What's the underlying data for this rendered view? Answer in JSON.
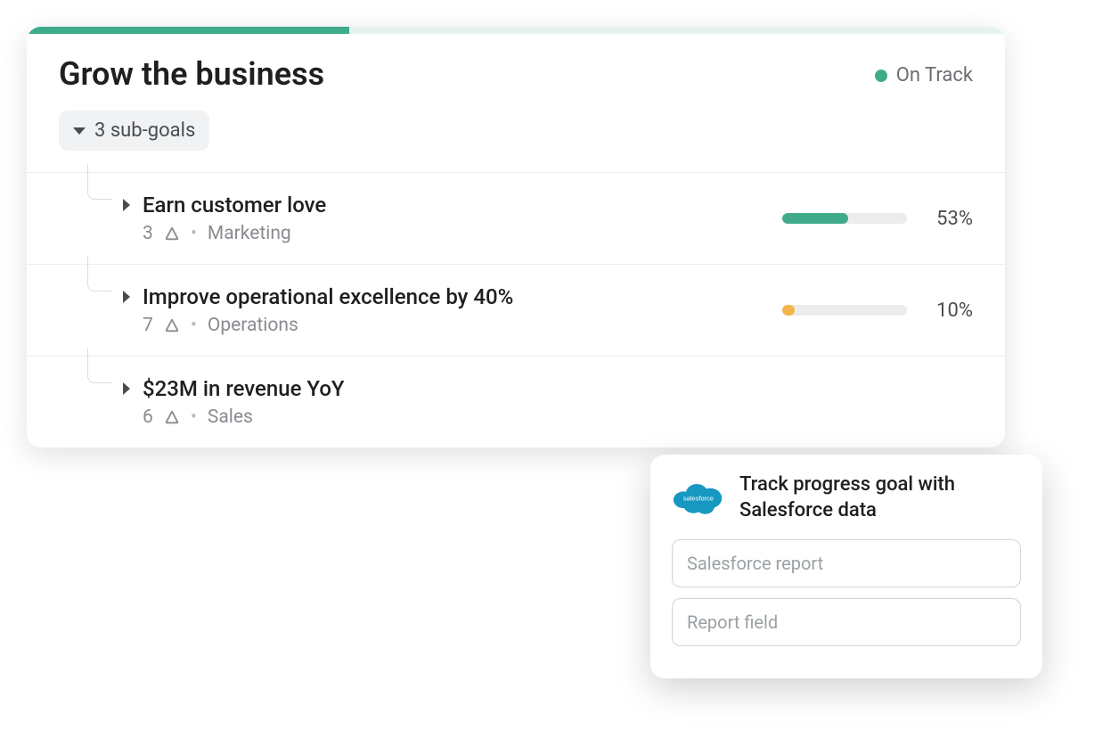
{
  "goal": {
    "title": "Grow the business",
    "status_label": "On Track",
    "status_color": "#3fab8b",
    "progress_header_pct": 33,
    "subgoals_chip": "3 sub-goals"
  },
  "subgoals": [
    {
      "title": "Earn customer love",
      "count": "3",
      "team": "Marketing",
      "pct": 53,
      "pct_label": "53%",
      "bar_color": "#3fab8b"
    },
    {
      "title": "Improve operational excellence by 40%",
      "count": "7",
      "team": "Operations",
      "pct": 10,
      "pct_label": "10%",
      "bar_color": "#f2b54b"
    },
    {
      "title": "$23M in revenue YoY",
      "count": "6",
      "team": "Sales",
      "pct": null,
      "pct_label": "",
      "bar_color": ""
    }
  ],
  "popover": {
    "title": "Track progress goal with Salesforce data",
    "input1_placeholder": "Salesforce report",
    "input2_placeholder": "Report field"
  },
  "colors": {
    "track_bg": "#e6f2ed",
    "track_fill": "#3fab8b",
    "bar_bg": "#ececec"
  }
}
